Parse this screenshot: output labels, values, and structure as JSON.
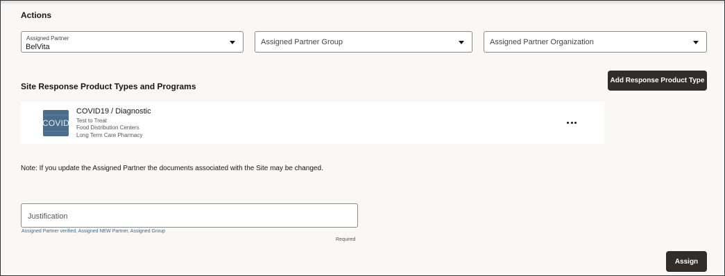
{
  "actions": {
    "title": "Actions",
    "assigned_partner": {
      "label": "Assigned Partner",
      "value": "BelVita"
    },
    "assigned_partner_group": {
      "placeholder": "Assigned Partner Group"
    },
    "assigned_partner_org": {
      "placeholder": "Assigned Partner Organization"
    }
  },
  "products": {
    "title": "Site Response Product Types and Programs",
    "add_button": "Add Response Product Type",
    "items": [
      {
        "thumb_text": "COVID",
        "title": "COVID19 / Diagnostic",
        "lines": [
          "Test to Treat",
          "Food Distribution Centers",
          "Long Term Care Pharmacy"
        ]
      }
    ]
  },
  "note": "Note: If you update the Assigned Partner the documents associated with the Site may be changed.",
  "justification": {
    "placeholder": "Justification",
    "value": "",
    "helper": "Assigned Partner verified, Assigned NEW Partner, Assigned Group",
    "required": "Required"
  },
  "assign_button": "Assign",
  "colors": {
    "button_bg": "#312d2a",
    "page_bg": "#f9f8f7",
    "thumb_bg": "#4b6d8c",
    "helper_text": "#3a6a8a"
  },
  "icons": {
    "dropdown": "caret-down-icon",
    "more": "more-horizontal-icon"
  }
}
